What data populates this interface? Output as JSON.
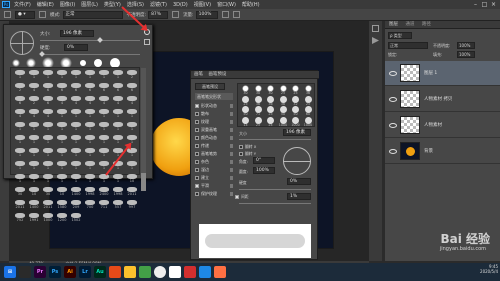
{
  "menubar": {
    "logo": "Ps",
    "items": [
      "文件(F)",
      "编辑(E)",
      "图像(I)",
      "图层(L)",
      "类型(Y)",
      "选择(S)",
      "滤镜(T)",
      "3D(D)",
      "视图(V)",
      "窗口(W)",
      "帮助(H)"
    ]
  },
  "options": {
    "mode_label": "模式:",
    "mode_value": "正常",
    "opacity_label": "不透明度:",
    "opacity_value": "87%",
    "flow_label": "流量:",
    "flow_value": "100%"
  },
  "brush_picker": {
    "size_label": "大小:",
    "size_value": "196 像素",
    "hardness_label": "硬度:",
    "hardness_value": "0%",
    "grid_labels": [
      "1",
      "1",
      "1",
      "1",
      "1",
      "1",
      "1",
      "1",
      "2",
      "2",
      "4",
      "6",
      "6",
      "6",
      "6",
      "6",
      "6",
      "6",
      "6",
      "2",
      "6",
      "4",
      "4",
      "4",
      "4",
      "4",
      "4",
      "4",
      "4",
      "4",
      "1",
      "1",
      "1",
      "1",
      "1",
      "1",
      "1",
      "1",
      "1",
      "1",
      "1",
      "1",
      "1",
      "1",
      "1",
      "1",
      "1",
      "1",
      "1",
      "1",
      "1",
      "1",
      "1",
      "1",
      "1",
      "1",
      "1",
      "1",
      "1",
      "1",
      "1",
      "1",
      "1",
      "1",
      "1",
      "1",
      "1",
      "1",
      "1",
      "1",
      "1",
      "1",
      "1",
      "1",
      "1",
      "1",
      "1",
      "1",
      "1",
      "1",
      "10",
      "30",
      "10",
      "30",
      "10",
      "1400",
      "1998",
      "2400",
      "1998",
      "2011",
      "2011",
      "1400",
      "2011",
      "1580",
      "209",
      "700",
      "711",
      "557",
      "997",
      "752",
      "1991",
      "1000",
      "1200",
      "1502"
    ]
  },
  "brush_panel": {
    "tabs": [
      "画笔",
      "画笔预设"
    ],
    "preset_button": "画笔预设",
    "tip_header": "画笔笔尖形状",
    "options": [
      {
        "label": "形状动态",
        "checked": true
      },
      {
        "label": "散布",
        "checked": false
      },
      {
        "label": "纹理",
        "checked": false
      },
      {
        "label": "双重画笔",
        "checked": false
      },
      {
        "label": "颜色动态",
        "checked": false
      },
      {
        "label": "传递",
        "checked": false
      },
      {
        "label": "画笔笔势",
        "checked": false
      },
      {
        "label": "杂色",
        "checked": false
      },
      {
        "label": "湿边",
        "checked": false
      },
      {
        "label": "建立",
        "checked": false
      },
      {
        "label": "平滑",
        "checked": true
      },
      {
        "label": "保护纹理",
        "checked": false
      }
    ],
    "tip_numbers": [
      "30",
      "30",
      "30",
      "25",
      "25",
      "36",
      "25",
      "36",
      "36",
      "36",
      "32",
      "25",
      "50",
      "71",
      "25",
      "50",
      "50",
      "60",
      "14",
      "25",
      "24",
      "1000",
      "1000",
      "1000"
    ],
    "size_label": "大小",
    "size_value": "196 像素",
    "flipx_label": "翻转 X",
    "flipy_label": "翻转 Y",
    "angle_label": "角度:",
    "angle_value": "0°",
    "roundness_label": "圆度:",
    "roundness_value": "100%",
    "hardness_label": "硬度",
    "hardness_value": "0%",
    "spacing_label": "间距",
    "spacing_value": "1%"
  },
  "layers": {
    "tabs": [
      "图层",
      "通道",
      "路径"
    ],
    "kind_label": "ρ 类型",
    "blend_value": "正常",
    "opacity_label": "不透明度:",
    "opacity_value": "100%",
    "lock_label": "锁定:",
    "fill_label": "填充:",
    "fill_value": "100%",
    "items": [
      {
        "name": "图层 1",
        "selected": true
      },
      {
        "name": "人物素材 拷贝",
        "selected": false
      },
      {
        "name": "人物素材",
        "selected": false
      },
      {
        "name": "背景",
        "selected": false
      }
    ]
  },
  "status": {
    "zoom": "49.77%",
    "doc": "文档:1.55M/4.99M"
  },
  "taskbar": {
    "apps": [
      "Pr",
      "Ps",
      "Ai",
      "Lr",
      "Au"
    ],
    "time": "9:45",
    "date": "2020/5/4"
  },
  "watermark": {
    "brand": "Bai 经验",
    "url": "jingyan.baidu.com"
  },
  "colors": {
    "accent_red": "#e53030",
    "ps_blue": "#31a8ff",
    "moon": "#f0a010"
  }
}
